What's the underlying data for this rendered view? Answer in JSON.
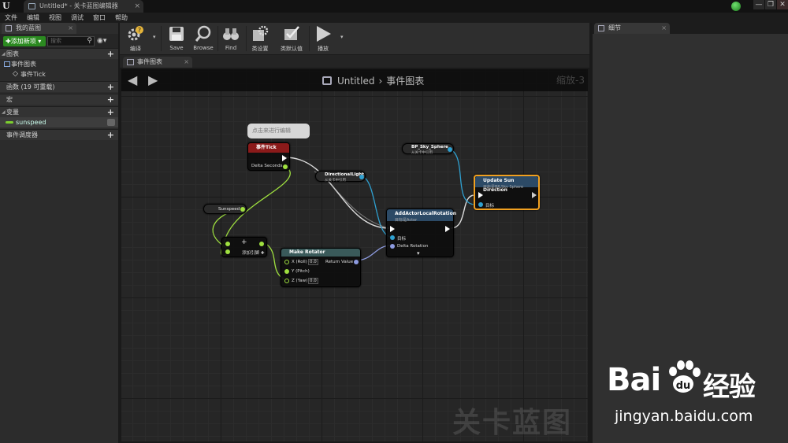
{
  "titlebar": {
    "tab_label": "Untitled* - 关卡蓝图编辑器",
    "close": "×",
    "win_min": "—",
    "win_max": "❐",
    "win_close": "✕"
  },
  "menu": [
    "文件",
    "编辑",
    "视图",
    "调试",
    "窗口",
    "帮助"
  ],
  "left_panel": {
    "tab": "我的蓝图",
    "add_button": "✚添加新项 ▾",
    "search_placeholder": "搜索",
    "sections": {
      "graphs": "图表",
      "graph_item": "事件图表",
      "event_tick": "事件Tick",
      "functions": "函数 (19 可重载)",
      "macros": "宏",
      "variables": "变量",
      "var_item": "sunspeed",
      "dispatchers": "事件调度器"
    }
  },
  "toolbar": {
    "compile": "编译",
    "save": "Save",
    "browse": "Browse",
    "find": "Find",
    "class_settings": "类设置",
    "class_defaults": "类默认值",
    "play": "播放"
  },
  "graph_tab": "事件图表",
  "graph": {
    "breadcrumb_root": "Untitled",
    "breadcrumb_sep": "›",
    "breadcrumb_leaf": "事件图表",
    "zoom": "缩放-3",
    "watermark": "关卡蓝图",
    "comment": "点击来进行编辑"
  },
  "nodes": {
    "event_tick": {
      "title": "事件Tick",
      "pin": "Delta Seconds"
    },
    "directional_light": {
      "title": "DirectionalLight",
      "sub": "从关卡中引用"
    },
    "bp_sky": {
      "title": "BP_Sky_Sphere",
      "sub": "从关卡中引用"
    },
    "update_sun": {
      "title": "Update Sun Direction",
      "sub": "目标是BP Sky Sphere",
      "pin_target": "目标"
    },
    "add_rotation": {
      "title": "AddActorLocalRotation",
      "sub": "目标是Actor",
      "pin_target": "目标",
      "pin_delta": "Delta Rotation"
    },
    "sunspeed": {
      "title": "Sunspeed"
    },
    "multiply": {
      "label": "添加引脚 ✚"
    },
    "make_rotator": {
      "title": "Make Rotator",
      "x": "X (Roll)",
      "y": "Y (Pitch)",
      "z": "Z (Yaw)",
      "xv": "0.0",
      "zv": "0.0",
      "ret": "Return Value"
    }
  },
  "right_panel": {
    "tab": "细节"
  },
  "watermark_site": {
    "logo_left": "Bai",
    "logo_right": "经验",
    "url": "jingyan.baidu.com"
  },
  "colors": {
    "accent_green": "#2b8a20",
    "event_red": "#8b1a1a",
    "func_blue": "#2c4a66",
    "float_green": "#7ccf2f",
    "object_blue": "#2fa0d0",
    "struct_violet": "#8d9be0"
  }
}
